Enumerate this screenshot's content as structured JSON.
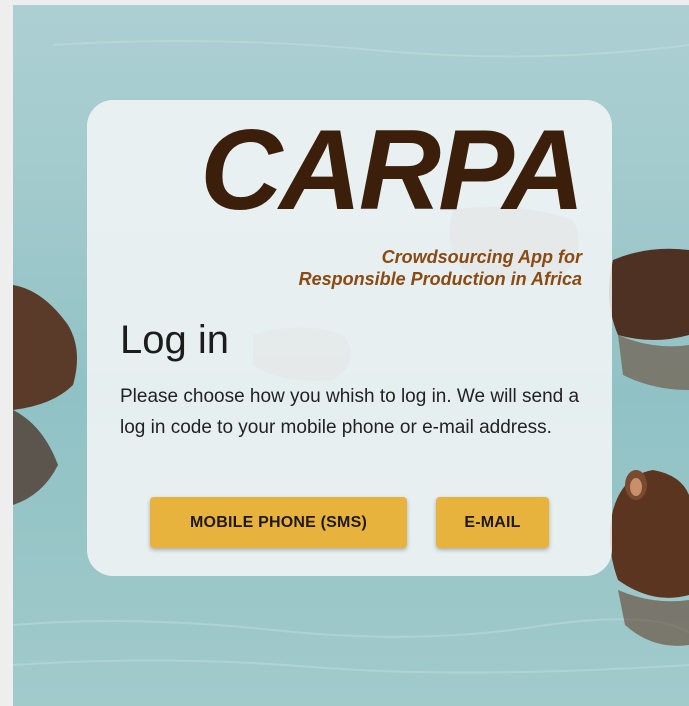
{
  "logo": {
    "word": "CARPA",
    "tagline_line1": "Crowdsourcing App for",
    "tagline_line2": "Responsible Production in Africa"
  },
  "login": {
    "title": "Log in",
    "description": "Please choose how you whish to log in. We will send a log in code to your mobile phone or e-mail address.",
    "sms_button": "MOBILE PHONE (SMS)",
    "email_button": "E-MAIL"
  },
  "colors": {
    "logo_text": "#3b1f0a",
    "tagline": "#8a4a12",
    "button": "#e8b33d",
    "water": "#9fc8cb"
  }
}
